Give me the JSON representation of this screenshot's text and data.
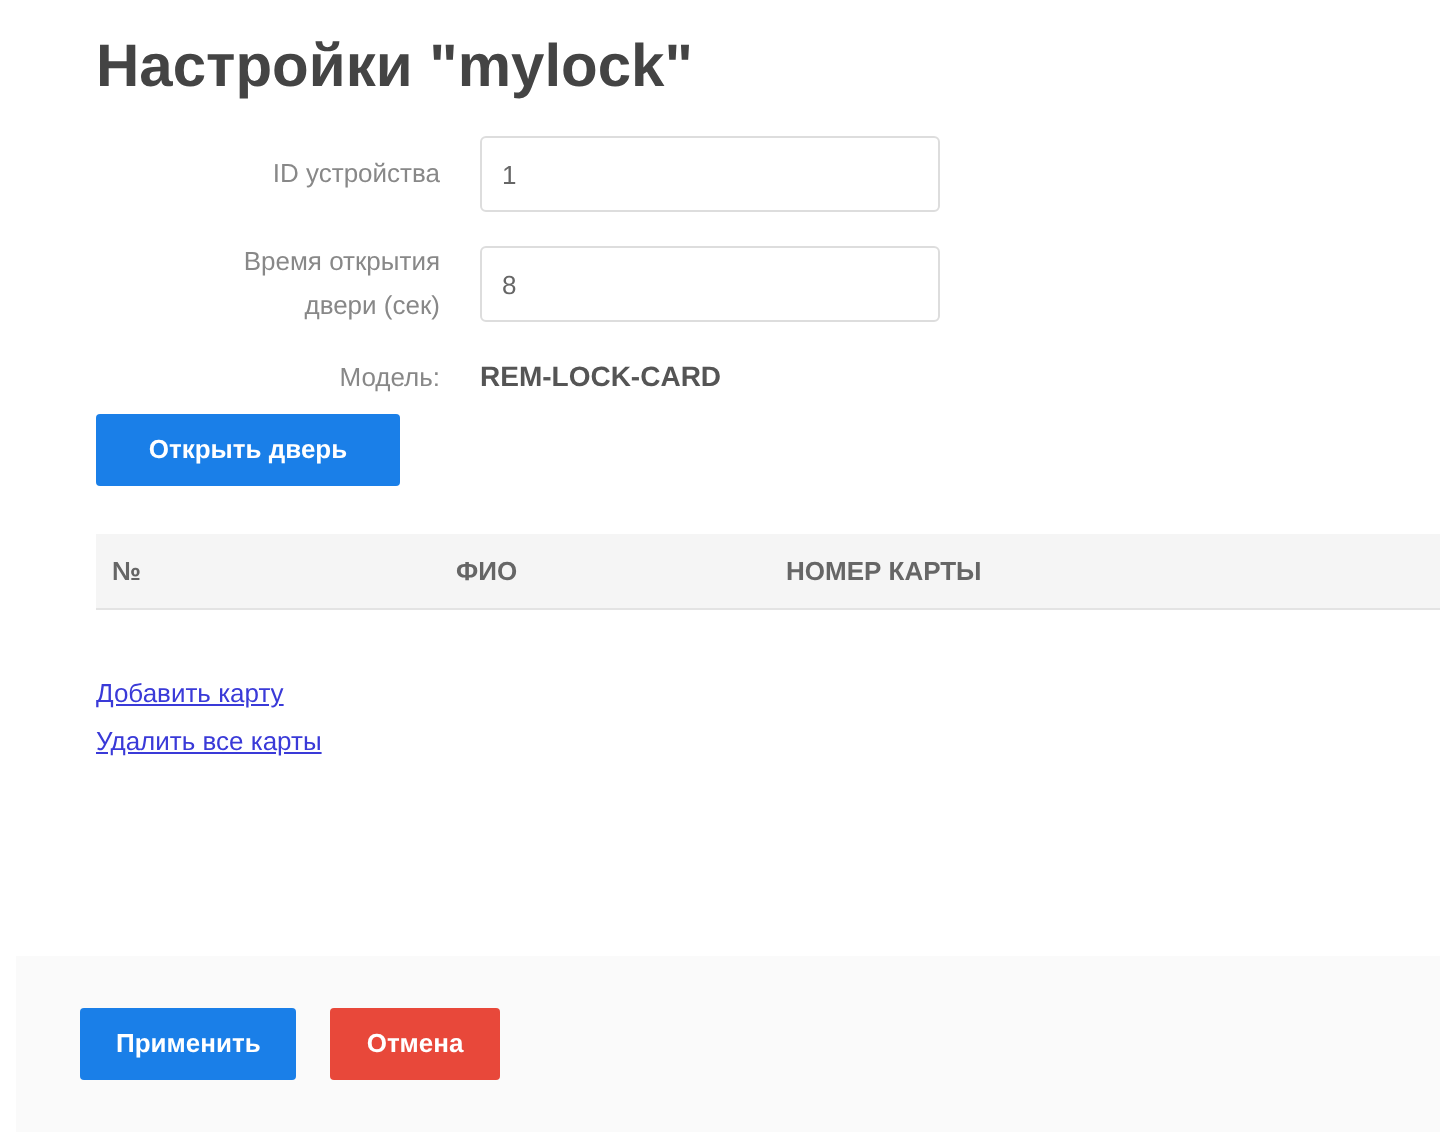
{
  "title": "Настройки \"mylock\"",
  "fields": [
    {
      "label": "ID устройства",
      "value": "1"
    },
    {
      "label": "Время открытия двери (сек)",
      "value": "8"
    }
  ],
  "model": {
    "label": "Модель:",
    "value": "REM-LOCK-CARD"
  },
  "open_button": "Открыть дверь",
  "table": {
    "columns": [
      "№",
      "ФИО",
      "НОМЕР КАРТЫ"
    ]
  },
  "links": [
    "Добавить карту",
    "Удалить все карты"
  ],
  "footer_buttons": [
    {
      "label": "Применить",
      "kind": "primary"
    },
    {
      "label": "Отмена",
      "kind": "danger"
    }
  ]
}
